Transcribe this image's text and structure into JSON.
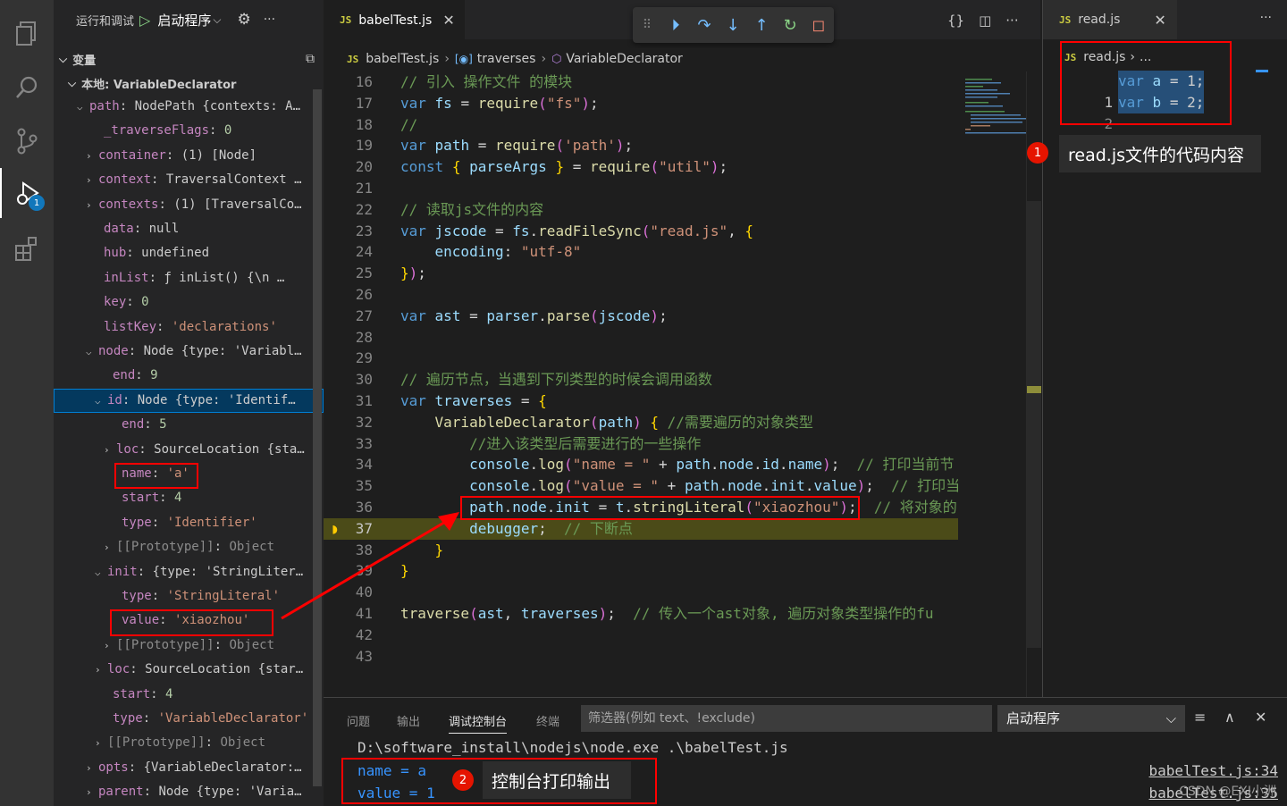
{
  "activity_bar": {
    "items": [
      "explorer-icon",
      "search-icon",
      "source-control-icon",
      "run-debug-icon",
      "extensions-icon"
    ],
    "debug_badge": "1"
  },
  "sidebar": {
    "run_label": "运行和调试",
    "config_name": "启动程序",
    "variables_title": "变量",
    "scope_title": "本地: VariableDeclarator",
    "rows": [
      {
        "key": "path",
        "value": "NodePath {contexts: A…",
        "expandable": true,
        "open": true
      },
      {
        "key": "_traverseFlags",
        "value": "0",
        "expandable": false
      },
      {
        "key": "container",
        "value": "(1) [Node]",
        "expandable": true
      },
      {
        "key": "context",
        "value": "TraversalContext …",
        "expandable": true
      },
      {
        "key": "contexts",
        "value": "(1) [TraversalCo…",
        "expandable": true
      },
      {
        "key": "data",
        "value": "null",
        "expandable": false
      },
      {
        "key": "hub",
        "value": "undefined",
        "expandable": false
      },
      {
        "key": "inList",
        "value": "ƒ inList() {\\n …",
        "expandable": false
      },
      {
        "key": "key",
        "value": "0",
        "expandable": false
      },
      {
        "key": "listKey",
        "value": "'declarations'",
        "expandable": false
      },
      {
        "key": "node",
        "value": "Node {type: 'Variabl…",
        "expandable": true,
        "open": true
      },
      {
        "key": "end",
        "value": "9",
        "expandable": false
      },
      {
        "key": "id",
        "value": "Node {type: 'Identif…",
        "expandable": true,
        "open": true
      },
      {
        "key": "end",
        "value": "5",
        "expandable": false
      },
      {
        "key": "loc",
        "value": "SourceLocation {sta…",
        "expandable": true
      },
      {
        "key": "name",
        "value": "'a'",
        "expandable": false
      },
      {
        "key": "start",
        "value": "4",
        "expandable": false
      },
      {
        "key": "type",
        "value": "'Identifier'",
        "expandable": false
      },
      {
        "key": "[[Prototype]]",
        "value": "Object",
        "expandable": true
      },
      {
        "key": "init",
        "value": "{type: 'StringLiter…",
        "expandable": true,
        "open": true
      },
      {
        "key": "type",
        "value": "'StringLiteral'",
        "expandable": false
      },
      {
        "key": "value",
        "value": "'xiaozhou'",
        "expandable": false
      },
      {
        "key": "[[Prototype]]",
        "value": "Object",
        "expandable": true
      },
      {
        "key": "loc",
        "value": "SourceLocation {star…",
        "expandable": true
      },
      {
        "key": "start",
        "value": "4",
        "expandable": false
      },
      {
        "key": "type",
        "value": "'VariableDeclarator'",
        "expandable": false
      },
      {
        "key": "[[Prototype]]",
        "value": "Object",
        "expandable": true
      },
      {
        "key": "opts",
        "value": "{VariableDeclarator:…",
        "expandable": true
      },
      {
        "key": "parent",
        "value": "Node {type: 'Varia…",
        "expandable": true
      }
    ]
  },
  "editor": {
    "tab_icon": "JS",
    "tab_name": "babelTest.js",
    "breadcrumb": [
      "babelTest.js",
      "traverses",
      "VariableDeclarator"
    ],
    "code_lines": [
      {
        "n": "16",
        "text": "// 引入 操作文件 的模块"
      },
      {
        "n": "17",
        "text": "var fs = require(\"fs\");"
      },
      {
        "n": "18",
        "text": "//"
      },
      {
        "n": "19",
        "text": "var path = require('path');"
      },
      {
        "n": "20",
        "text": "const { parseArgs } = require(\"util\");"
      },
      {
        "n": "21",
        "text": ""
      },
      {
        "n": "22",
        "text": "// 读取js文件的内容"
      },
      {
        "n": "23",
        "text": "var jscode = fs.readFileSync(\"read.js\", {"
      },
      {
        "n": "24",
        "text": "    encoding: \"utf-8\""
      },
      {
        "n": "25",
        "text": "});"
      },
      {
        "n": "26",
        "text": ""
      },
      {
        "n": "27",
        "text": "var ast = parser.parse(jscode);"
      },
      {
        "n": "28",
        "text": ""
      },
      {
        "n": "29",
        "text": ""
      },
      {
        "n": "30",
        "text": "// 遍历节点，当遇到下列类型的时候会调用函数"
      },
      {
        "n": "31",
        "text": "var traverses = {"
      },
      {
        "n": "32",
        "text": "    VariableDeclarator(path) { //需要遍历的对象类型"
      },
      {
        "n": "33",
        "text": "        //进入该类型后需要进行的一些操作"
      },
      {
        "n": "34",
        "text": "        console.log(\"name = \" + path.node.id.name);  // 打印当前节"
      },
      {
        "n": "35",
        "text": "        console.log(\"value = \" + path.node.init.value);  // 打印当"
      },
      {
        "n": "36",
        "text": "        path.node.init = t.stringLiteral(\"xiaozhou\");  // 将对象的"
      },
      {
        "n": "37",
        "text": "        debugger;  // 下断点"
      },
      {
        "n": "38",
        "text": "    }"
      },
      {
        "n": "39",
        "text": "}"
      },
      {
        "n": "40",
        "text": ""
      },
      {
        "n": "41",
        "text": "traverse(ast, traverses);  // 传入一个ast对象, 遍历对象类型操作的fu"
      },
      {
        "n": "42",
        "text": ""
      },
      {
        "n": "43",
        "text": ""
      }
    ]
  },
  "right_editor": {
    "tab_icon": "JS",
    "tab_name": "read.js",
    "breadcrumb": [
      "read.js",
      "..."
    ],
    "lines": [
      {
        "n": "1",
        "text": "var a = 1;"
      },
      {
        "n": "2",
        "text": "var b = 2;"
      }
    ]
  },
  "callouts": {
    "one_num": "1",
    "one_text": "read.js文件的代码内容",
    "two_num": "2",
    "two_text": "控制台打印输出"
  },
  "panel": {
    "tabs": [
      "问题",
      "输出",
      "调试控制台",
      "终端"
    ],
    "active_tab": "调试控制台",
    "filter_placeholder": "筛选器(例如 text、!exclude)",
    "select_value": "启动程序",
    "command_line": "D:\\software_install\\nodejs\\node.exe .\\babelTest.js",
    "outputs": [
      {
        "text": "name = a",
        "source": "babelTest.js:34"
      },
      {
        "text": "value = 1",
        "source": "babelTest.js:35"
      }
    ],
    "watermark": "CSDN @EXI小洲"
  }
}
